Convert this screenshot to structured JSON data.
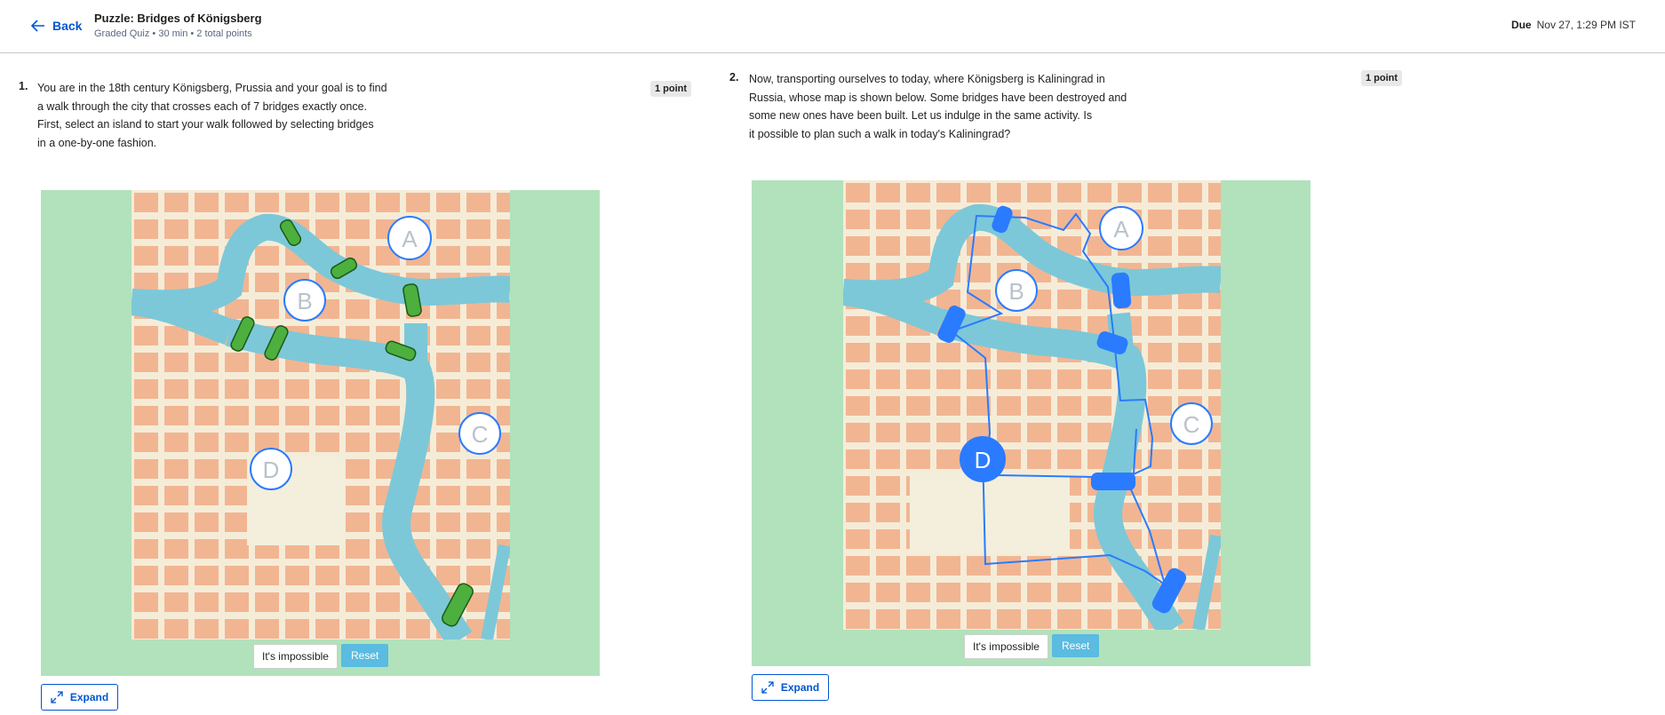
{
  "header": {
    "back_label": "Back",
    "quiz_title": "Puzzle: Bridges of Königsberg",
    "quiz_meta": "Graded Quiz • 30 min • 2 total points",
    "due_label": "Due",
    "due_value": "Nov 27, 1:29 PM IST"
  },
  "questions": [
    {
      "number": "1.",
      "text": "You are in the 18th century Königsberg, Prussia and your goal is to find\n  a walk through the city that crosses each of 7 bridges exactly once.\nFirst, select an island to start your walk followed by selecting bridges\n  in a one-by-one fashion.",
      "points": "1 point",
      "islands": [
        "A",
        "B",
        "C",
        "D"
      ],
      "impossible_label": "It's impossible",
      "reset_label": "Reset",
      "expand_label": "Expand"
    },
    {
      "number": "2.",
      "text": "Now, transporting ourselves to today, where Königsberg is Kaliningrad in\n  Russia, whose map is shown below. Some bridges have been destroyed and\nsome new ones have been built. Let us indulge in the same activity. Is\nit possible to plan such a walk in today's Kaliningrad?",
      "points": "1 point",
      "islands": [
        "A",
        "B",
        "C",
        "D"
      ],
      "selected_island": "D",
      "impossible_label": "It's impossible",
      "reset_label": "Reset",
      "expand_label": "Expand"
    }
  ],
  "colors": {
    "accent": "#0056d2",
    "panel_bg": "#b1e2bc",
    "river": "#7cc8d8",
    "bridge_old": "#4caf3e",
    "bridge_new": "#2a7bff",
    "reset_btn": "#5bbbe0"
  }
}
